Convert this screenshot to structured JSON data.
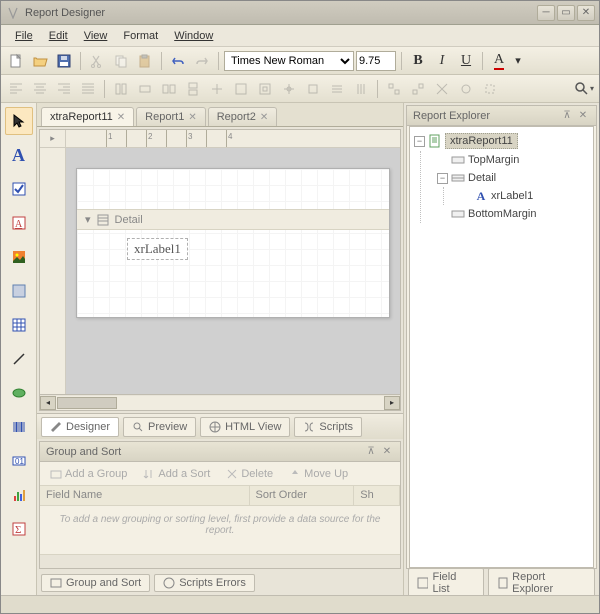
{
  "window": {
    "title": "Report Designer"
  },
  "menu": {
    "file": "File",
    "edit": "Edit",
    "view": "View",
    "format": "Format",
    "window": "Window"
  },
  "font_toolbar": {
    "font_name": "Times New Roman",
    "font_size": "9.75",
    "bold": "B",
    "italic": "I",
    "underline": "U",
    "color": "A"
  },
  "doc_tabs": [
    {
      "label": "xtraReport11",
      "active": true
    },
    {
      "label": "Report1",
      "active": false
    },
    {
      "label": "Report2",
      "active": false
    }
  ],
  "design": {
    "band_label": "Detail",
    "label_text": "xrLabel1"
  },
  "view_tabs": {
    "designer": "Designer",
    "preview": "Preview",
    "html": "HTML View",
    "scripts": "Scripts"
  },
  "group_sort": {
    "title": "Group and Sort",
    "add_group": "Add a Group",
    "add_sort": "Add a Sort",
    "delete": "Delete",
    "move_up": "Move Up",
    "col_field": "Field Name",
    "col_order": "Sort Order",
    "col_show": "Sh",
    "empty_text": "To add a new grouping or sorting level, first provide a data source for the report."
  },
  "bottom_tabs": {
    "group_sort": "Group and Sort",
    "scripts_errors": "Scripts Errors"
  },
  "explorer": {
    "title": "Report Explorer",
    "root": "xtraReport11",
    "items": {
      "top_margin": "TopMargin",
      "detail": "Detail",
      "xr_label": "xrLabel1",
      "bottom_margin": "BottomMargin"
    },
    "tabs": {
      "field_list": "Field List",
      "report_explorer": "Report Explorer"
    }
  }
}
